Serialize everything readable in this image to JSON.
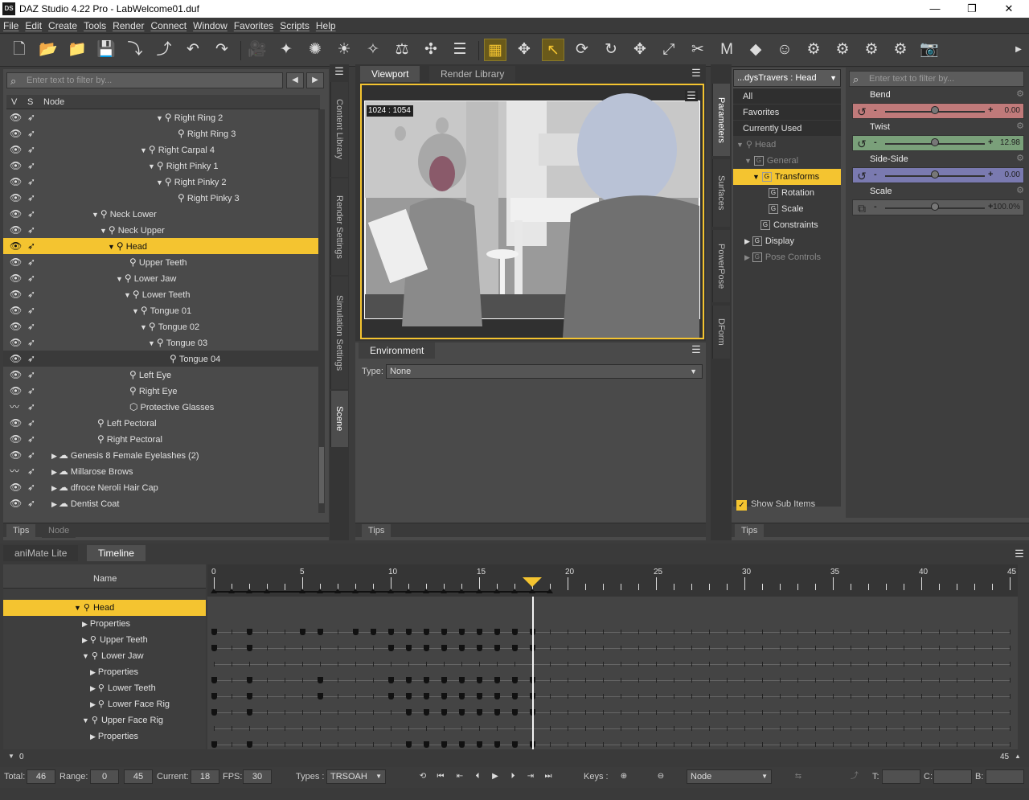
{
  "app": {
    "title": "DAZ Studio 4.22 Pro - LabWelcome01.duf",
    "logo_text": "DS",
    "window_controls": [
      "—",
      "❐",
      "✕"
    ]
  },
  "menu": [
    "File",
    "Edit",
    "Create",
    "Tools",
    "Render",
    "Connect",
    "Window",
    "Favorites",
    "Scripts",
    "Help"
  ],
  "toolbar": {
    "icons": [
      "new-file",
      "open-file",
      "merge-file",
      "save",
      "import",
      "export",
      "undo",
      "redo",
      "create-camera",
      "spot-light",
      "point-light",
      "distant-light",
      "linear-light",
      "node-weight",
      "geometry-editor",
      "layout",
      "tile-grid",
      "universal-tool",
      "node-selection",
      "rotate-view",
      "rotate",
      "translate",
      "scale",
      "joint-editor",
      "morph-tool",
      "surface-selection",
      "figure-tool",
      "render-settings",
      "active-pose",
      "render-bake",
      "render-settings-2",
      "render-camera"
    ],
    "active_indices": [
      16,
      18
    ]
  },
  "scene": {
    "filter_placeholder": "Enter text to filter by...",
    "columns": {
      "v": "V",
      "s": "S",
      "node": "Node"
    },
    "rows": [
      {
        "label": "Right Ring 2",
        "indent": 190,
        "tri": "▼",
        "sel": false
      },
      {
        "label": "Right Ring 3",
        "indent": 210,
        "tri": "",
        "sel": false
      },
      {
        "label": "Right Carpal 4",
        "indent": 170,
        "tri": "▼",
        "sel": false
      },
      {
        "label": "Right Pinky 1",
        "indent": 180,
        "tri": "▼",
        "sel": false
      },
      {
        "label": "Right Pinky 2",
        "indent": 190,
        "tri": "▼",
        "sel": false
      },
      {
        "label": "Right Pinky 3",
        "indent": 210,
        "tri": "",
        "sel": false
      },
      {
        "label": "Neck Lower",
        "indent": 110,
        "tri": "▼",
        "sel": false
      },
      {
        "label": "Neck Upper",
        "indent": 120,
        "tri": "▼",
        "sel": false
      },
      {
        "label": "Head",
        "indent": 130,
        "tri": "▼",
        "sel": true
      },
      {
        "label": "Upper Teeth",
        "indent": 150,
        "tri": "",
        "sel": false
      },
      {
        "label": "Lower Jaw",
        "indent": 140,
        "tri": "▼",
        "sel": false
      },
      {
        "label": "Lower Teeth",
        "indent": 150,
        "tri": "▼",
        "sel": false
      },
      {
        "label": "Tongue 01",
        "indent": 160,
        "tri": "▼",
        "sel": false
      },
      {
        "label": "Tongue 02",
        "indent": 170,
        "tri": "▼",
        "sel": false
      },
      {
        "label": "Tongue 03",
        "indent": 180,
        "tri": "▼",
        "sel": false
      },
      {
        "label": "Tongue 04",
        "indent": 200,
        "tri": "",
        "sel": false
      },
      {
        "label": "Left Eye",
        "indent": 150,
        "tri": "",
        "sel": false
      },
      {
        "label": "Right Eye",
        "indent": 150,
        "tri": "",
        "sel": false
      },
      {
        "label": "Protective Glasses",
        "indent": 150,
        "tri": "",
        "sel": false
      },
      {
        "label": "Left Pectoral",
        "indent": 110,
        "tri": "",
        "sel": false
      },
      {
        "label": "Right Pectoral",
        "indent": 110,
        "tri": "",
        "sel": false
      },
      {
        "label": "Genesis 8 Female Eyelashes (2)",
        "indent": 60,
        "tri": "▶",
        "sel": false
      },
      {
        "label": "Millarose Brows",
        "indent": 60,
        "tri": "▶",
        "sel": false
      },
      {
        "label": "dfroce Neroli Hair Cap",
        "indent": 60,
        "tri": "▶",
        "sel": false
      },
      {
        "label": "Dentist Coat",
        "indent": 60,
        "tri": "▶",
        "sel": false
      }
    ],
    "bottom_tabs": [
      "Tips",
      "Node"
    ]
  },
  "side_tabs_left": [
    "Content Library",
    "Render Settings",
    "Simulation Settings",
    "Scene"
  ],
  "viewport": {
    "tabs": [
      "Viewport",
      "Render Library"
    ],
    "overlay_text": "1024 : 1054"
  },
  "environment": {
    "title": "Environment",
    "type_label": "Type:",
    "type_value": "None",
    "bottom_tab": "Tips"
  },
  "side_tabs_right": [
    "Parameters",
    "Surfaces",
    "PowerPose",
    "DForm"
  ],
  "parameters": {
    "node_selector": "...dysTravers : Head",
    "filter_placeholder": "Enter text to filter by...",
    "tree": [
      {
        "label": "All",
        "indent": 12,
        "kind": "plain",
        "sel": false,
        "dim": false
      },
      {
        "label": "Favorites",
        "indent": 12,
        "kind": "plain",
        "sel": false,
        "dim": false
      },
      {
        "label": "Currently Used",
        "indent": 12,
        "kind": "plain",
        "sel": false,
        "dim": false
      },
      {
        "label": "Head",
        "indent": 4,
        "kind": "bone",
        "sel": false,
        "dim": true
      },
      {
        "label": "General",
        "indent": 14,
        "kind": "group",
        "sel": false,
        "dim": true
      },
      {
        "label": "Transforms",
        "indent": 24,
        "kind": "group",
        "sel": true,
        "dim": false
      },
      {
        "label": "Rotation",
        "indent": 44,
        "kind": "group",
        "sel": false,
        "dim": false
      },
      {
        "label": "Scale",
        "indent": 44,
        "kind": "group",
        "sel": false,
        "dim": false
      },
      {
        "label": "Constraints",
        "indent": 34,
        "kind": "group",
        "sel": false,
        "dim": false
      },
      {
        "label": "Display",
        "indent": 14,
        "kind": "group",
        "sel": false,
        "dim": false
      },
      {
        "label": "Pose Controls",
        "indent": 14,
        "kind": "group",
        "sel": false,
        "dim": true
      }
    ],
    "show_sub_items": "Show Sub Items",
    "sliders": [
      {
        "label": "Bend",
        "value": "0.00",
        "color": "#c07a7a",
        "knob": 0.5
      },
      {
        "label": "Twist",
        "value": "12.98",
        "color": "#7aa07a",
        "knob": 0.5
      },
      {
        "label": "Side-Side",
        "value": "0.00",
        "color": "#7a7ab0",
        "knob": 0.5
      },
      {
        "label": "Scale",
        "value": "100.0%",
        "color": "#5c5c5c",
        "knob": 0.5
      }
    ],
    "bottom_tab": "Tips"
  },
  "timeline": {
    "tabs": [
      "aniMate Lite",
      "Timeline"
    ],
    "name_header": "Name",
    "rows": [
      {
        "label": "Head",
        "indent": 88,
        "tri": "▼",
        "bone": true,
        "sel": true
      },
      {
        "label": "Properties",
        "indent": 98,
        "tri": "▶",
        "bone": false,
        "sel": false
      },
      {
        "label": "Upper Teeth",
        "indent": 98,
        "tri": "▶",
        "bone": true,
        "sel": false
      },
      {
        "label": "Lower Jaw",
        "indent": 98,
        "tri": "▼",
        "bone": true,
        "sel": false
      },
      {
        "label": "Properties",
        "indent": 108,
        "tri": "▶",
        "bone": false,
        "sel": false
      },
      {
        "label": "Lower Teeth",
        "indent": 108,
        "tri": "▶",
        "bone": true,
        "sel": false
      },
      {
        "label": "Lower Face Rig",
        "indent": 108,
        "tri": "▶",
        "bone": true,
        "sel": false
      },
      {
        "label": "Upper Face Rig",
        "indent": 98,
        "tri": "▼",
        "bone": true,
        "sel": false
      },
      {
        "label": "Properties",
        "indent": 108,
        "tri": "▶",
        "bone": false,
        "sel": false
      }
    ],
    "ruler_labels": [
      "0",
      "5",
      "10",
      "15",
      "20",
      "25",
      "30",
      "35",
      "40",
      "45"
    ],
    "current_frame": 18,
    "top_keys": [
      0,
      1,
      2,
      3,
      5,
      6,
      7,
      8,
      9,
      10,
      11,
      12,
      13,
      14,
      15,
      16,
      17,
      18,
      19
    ],
    "row_keys": [
      [
        0,
        2,
        5,
        6,
        8,
        9,
        10,
        11,
        12,
        13,
        14,
        15,
        16,
        17,
        18
      ],
      [
        0,
        2,
        10,
        11,
        12,
        13,
        14,
        15,
        16,
        17,
        18
      ],
      [],
      [
        0,
        2,
        6,
        10,
        11,
        12,
        13,
        14,
        15,
        16,
        17,
        18
      ],
      [
        0,
        2,
        6,
        10,
        11,
        12,
        13,
        14,
        15,
        16,
        17,
        18
      ],
      [
        0,
        2,
        11,
        12,
        13,
        14,
        15,
        16,
        17,
        18
      ],
      [],
      [
        0,
        2,
        11,
        12,
        13,
        14,
        15,
        16,
        17,
        18
      ]
    ],
    "scroll_start": "0",
    "scroll_end": "45",
    "status": {
      "total_label": "Total:",
      "total": "46",
      "range_label": "Range:",
      "range_start": "0",
      "range_end": "45",
      "current_label": "Current:",
      "current": "18",
      "fps_label": "FPS:",
      "fps": "30",
      "types_label": "Types :",
      "types_value": "TRSOAH",
      "keys_label": "Keys :",
      "node_value": "Node",
      "t_label": "T:",
      "c_label": "C:",
      "b_label": "B:"
    }
  }
}
